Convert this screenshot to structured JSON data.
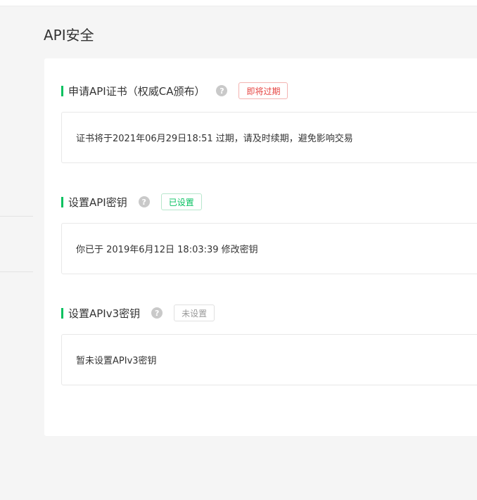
{
  "page": {
    "title": "API安全"
  },
  "sections": [
    {
      "title": "申请API证书（权威CA颁布）",
      "help_icon": "question-icon",
      "badge": "即将过期",
      "badge_color": "#e64340",
      "message": "证书将于2021年06月29日18:51 过期，请及时续期，避免影响交易"
    },
    {
      "title": "设置API密钥",
      "help_icon": "question-icon",
      "badge": "已设置",
      "badge_color": "#07c160",
      "message": "你已于 2019年6月12日 18:03:39 修改密钥"
    },
    {
      "title": "设置APIv3密钥",
      "help_icon": "question-icon",
      "badge": "未设置",
      "badge_color": "#999999",
      "message": "暂未设置APIv3密钥"
    }
  ],
  "colors": {
    "accent": "#07c160",
    "warning": "#e64340",
    "muted": "#999999"
  }
}
